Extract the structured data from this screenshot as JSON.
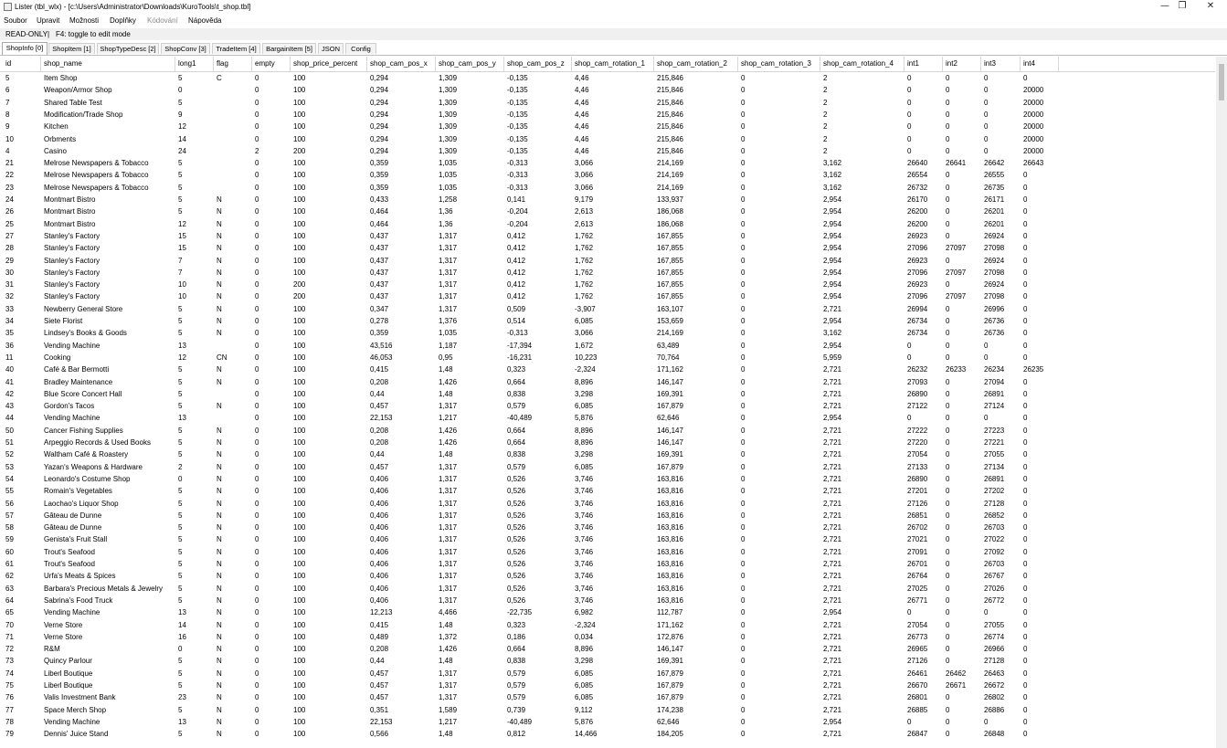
{
  "window": {
    "title": "Lister (tbl_wlx) - [c:\\Users\\Administrator\\Downloads\\KuroTools\\t_shop.tbl]",
    "minimize_glyph": "—",
    "restore_glyph": "❐",
    "close_glyph": "✕"
  },
  "menu": [
    "Soubor",
    "Upravit",
    "Možnosti",
    "Doplňky",
    "Kódování",
    "Nápověda"
  ],
  "status": {
    "mode": "READ-ONLY",
    "separator": "|",
    "hint": "F4: toggle to edit mode"
  },
  "tabs": [
    "ShopInfo [0]",
    "ShopItem [1]",
    "ShopTypeDesc [2]",
    "ShopConv [3]",
    "TradeItem [4]",
    "BargainItem [5]",
    "JSON",
    "Config"
  ],
  "active_tab": 0,
  "columns": [
    "id",
    "shop_name",
    "long1",
    "flag",
    "empty",
    "shop_price_percent",
    "shop_cam_pos_x",
    "shop_cam_pos_y",
    "shop_cam_pos_z",
    "shop_cam_rotation_1",
    "shop_cam_rotation_2",
    "shop_cam_rotation_3",
    "shop_cam_rotation_4",
    "int1",
    "int2",
    "int3",
    "int4"
  ],
  "rows": [
    [
      "5",
      "Item Shop",
      "5",
      "C",
      "0",
      "100",
      "0,294",
      "1,309",
      "-0,135",
      "4,46",
      "215,846",
      "0",
      "2",
      "0",
      "0",
      "0",
      "0"
    ],
    [
      "6",
      "Weapon/Armor Shop",
      "0",
      "",
      "0",
      "100",
      "0,294",
      "1,309",
      "-0,135",
      "4,46",
      "215,846",
      "0",
      "2",
      "0",
      "0",
      "0",
      "20000"
    ],
    [
      "7",
      "Shared Table Test",
      "5",
      "",
      "0",
      "100",
      "0,294",
      "1,309",
      "-0,135",
      "4,46",
      "215,846",
      "0",
      "2",
      "0",
      "0",
      "0",
      "20000"
    ],
    [
      "8",
      "Modification/Trade Shop",
      "9",
      "",
      "0",
      "100",
      "0,294",
      "1,309",
      "-0,135",
      "4,46",
      "215,846",
      "0",
      "2",
      "0",
      "0",
      "0",
      "20000"
    ],
    [
      "9",
      "Kitchen",
      "12",
      "",
      "0",
      "100",
      "0,294",
      "1,309",
      "-0,135",
      "4,46",
      "215,846",
      "0",
      "2",
      "0",
      "0",
      "0",
      "20000"
    ],
    [
      "10",
      "Orbments",
      "14",
      "",
      "0",
      "100",
      "0,294",
      "1,309",
      "-0,135",
      "4,46",
      "215,846",
      "0",
      "2",
      "0",
      "0",
      "0",
      "20000"
    ],
    [
      "4",
      "Casino",
      "24",
      "",
      "2",
      "200",
      "0,294",
      "1,309",
      "-0,135",
      "4,46",
      "215,846",
      "0",
      "2",
      "0",
      "0",
      "0",
      "20000"
    ],
    [
      "21",
      "Melrose Newspapers & Tobacco",
      "5",
      "",
      "0",
      "100",
      "0,359",
      "1,035",
      "-0,313",
      "3,066",
      "214,169",
      "0",
      "3,162",
      "26640",
      "26641",
      "26642",
      "26643"
    ],
    [
      "22",
      "Melrose Newspapers & Tobacco",
      "5",
      "",
      "0",
      "100",
      "0,359",
      "1,035",
      "-0,313",
      "3,066",
      "214,169",
      "0",
      "3,162",
      "26554",
      "0",
      "26555",
      "0"
    ],
    [
      "23",
      "Melrose Newspapers & Tobacco",
      "5",
      "",
      "0",
      "100",
      "0,359",
      "1,035",
      "-0,313",
      "3,066",
      "214,169",
      "0",
      "3,162",
      "26732",
      "0",
      "26735",
      "0"
    ],
    [
      "24",
      "Montmart Bistro",
      "5",
      "N",
      "0",
      "100",
      "0,433",
      "1,258",
      "0,141",
      "9,179",
      "133,937",
      "0",
      "2,954",
      "26170",
      "0",
      "26171",
      "0"
    ],
    [
      "26",
      "Montmart Bistro",
      "5",
      "N",
      "0",
      "100",
      "0,464",
      "1,36",
      "-0,204",
      "2,613",
      "186,068",
      "0",
      "2,954",
      "26200",
      "0",
      "26201",
      "0"
    ],
    [
      "25",
      "Montmart Bistro",
      "12",
      "N",
      "0",
      "100",
      "0,464",
      "1,36",
      "-0,204",
      "2,613",
      "186,068",
      "0",
      "2,954",
      "26200",
      "0",
      "26201",
      "0"
    ],
    [
      "27",
      "Stanley's Factory",
      "15",
      "N",
      "0",
      "100",
      "0,437",
      "1,317",
      "0,412",
      "1,762",
      "167,855",
      "0",
      "2,954",
      "26923",
      "0",
      "26924",
      "0"
    ],
    [
      "28",
      "Stanley's Factory",
      "15",
      "N",
      "0",
      "100",
      "0,437",
      "1,317",
      "0,412",
      "1,762",
      "167,855",
      "0",
      "2,954",
      "27096",
      "27097",
      "27098",
      "0"
    ],
    [
      "29",
      "Stanley's Factory",
      "7",
      "N",
      "0",
      "100",
      "0,437",
      "1,317",
      "0,412",
      "1,762",
      "167,855",
      "0",
      "2,954",
      "26923",
      "0",
      "26924",
      "0"
    ],
    [
      "30",
      "Stanley's Factory",
      "7",
      "N",
      "0",
      "100",
      "0,437",
      "1,317",
      "0,412",
      "1,762",
      "167,855",
      "0",
      "2,954",
      "27096",
      "27097",
      "27098",
      "0"
    ],
    [
      "31",
      "Stanley's Factory",
      "10",
      "N",
      "0",
      "200",
      "0,437",
      "1,317",
      "0,412",
      "1,762",
      "167,855",
      "0",
      "2,954",
      "26923",
      "0",
      "26924",
      "0"
    ],
    [
      "32",
      "Stanley's Factory",
      "10",
      "N",
      "0",
      "200",
      "0,437",
      "1,317",
      "0,412",
      "1,762",
      "167,855",
      "0",
      "2,954",
      "27096",
      "27097",
      "27098",
      "0"
    ],
    [
      "33",
      "Newberry General Store",
      "5",
      "N",
      "0",
      "100",
      "0,347",
      "1,317",
      "0,509",
      "-3,907",
      "163,107",
      "0",
      "2,721",
      "26994",
      "0",
      "26996",
      "0"
    ],
    [
      "34",
      "Siete Florist",
      "5",
      "N",
      "0",
      "100",
      "0,278",
      "1,376",
      "0,514",
      "6,085",
      "153,659",
      "0",
      "2,954",
      "26734",
      "0",
      "26736",
      "0"
    ],
    [
      "35",
      "Lindsey's Books & Goods",
      "5",
      "N",
      "0",
      "100",
      "0,359",
      "1,035",
      "-0,313",
      "3,066",
      "214,169",
      "0",
      "3,162",
      "26734",
      "0",
      "26736",
      "0"
    ],
    [
      "36",
      "Vending Machine",
      "13",
      "",
      "0",
      "100",
      "43,516",
      "1,187",
      "-17,394",
      "1,672",
      "63,489",
      "0",
      "2,954",
      "0",
      "0",
      "0",
      "0"
    ],
    [
      "11",
      "Cooking",
      "12",
      "CN",
      "0",
      "100",
      "46,053",
      "0,95",
      "-16,231",
      "10,223",
      "70,764",
      "0",
      "5,959",
      "0",
      "0",
      "0",
      "0"
    ],
    [
      "40",
      "Café & Bar Bermotti",
      "5",
      "N",
      "0",
      "100",
      "0,415",
      "1,48",
      "0,323",
      "-2,324",
      "171,162",
      "0",
      "2,721",
      "26232",
      "26233",
      "26234",
      "26235"
    ],
    [
      "41",
      "Bradley Maintenance",
      "5",
      "N",
      "0",
      "100",
      "0,208",
      "1,426",
      "0,664",
      "8,896",
      "146,147",
      "0",
      "2,721",
      "27093",
      "0",
      "27094",
      "0"
    ],
    [
      "42",
      "Blue Score Concert Hall",
      "5",
      "",
      "0",
      "100",
      "0,44",
      "1,48",
      "0,838",
      "3,298",
      "169,391",
      "0",
      "2,721",
      "26890",
      "0",
      "26891",
      "0"
    ],
    [
      "43",
      "Gordon's Tacos",
      "5",
      "N",
      "0",
      "100",
      "0,457",
      "1,317",
      "0,579",
      "6,085",
      "167,879",
      "0",
      "2,721",
      "27122",
      "0",
      "27124",
      "0"
    ],
    [
      "44",
      "Vending Machine",
      "13",
      "",
      "0",
      "100",
      "22,153",
      "1,217",
      "-40,489",
      "5,876",
      "62,646",
      "0",
      "2,954",
      "0",
      "0",
      "0",
      "0"
    ],
    [
      "50",
      "Cancer Fishing Supplies",
      "5",
      "N",
      "0",
      "100",
      "0,208",
      "1,426",
      "0,664",
      "8,896",
      "146,147",
      "0",
      "2,721",
      "27222",
      "0",
      "27223",
      "0"
    ],
    [
      "51",
      "Arpeggio Records & Used Books",
      "5",
      "N",
      "0",
      "100",
      "0,208",
      "1,426",
      "0,664",
      "8,896",
      "146,147",
      "0",
      "2,721",
      "27220",
      "0",
      "27221",
      "0"
    ],
    [
      "52",
      "Waltham Café & Roastery",
      "5",
      "N",
      "0",
      "100",
      "0,44",
      "1,48",
      "0,838",
      "3,298",
      "169,391",
      "0",
      "2,721",
      "27054",
      "0",
      "27055",
      "0"
    ],
    [
      "53",
      "Yazan's Weapons & Hardware",
      "2",
      "N",
      "0",
      "100",
      "0,457",
      "1,317",
      "0,579",
      "6,085",
      "167,879",
      "0",
      "2,721",
      "27133",
      "0",
      "27134",
      "0"
    ],
    [
      "54",
      "Leonardo's Costume Shop",
      "0",
      "N",
      "0",
      "100",
      "0,406",
      "1,317",
      "0,526",
      "3,746",
      "163,816",
      "0",
      "2,721",
      "26890",
      "0",
      "26891",
      "0"
    ],
    [
      "55",
      "Romain's Vegetables",
      "5",
      "N",
      "0",
      "100",
      "0,406",
      "1,317",
      "0,526",
      "3,746",
      "163,816",
      "0",
      "2,721",
      "27201",
      "0",
      "27202",
      "0"
    ],
    [
      "56",
      "Laochao's Liquor Shop",
      "5",
      "N",
      "0",
      "100",
      "0,406",
      "1,317",
      "0,526",
      "3,746",
      "163,816",
      "0",
      "2,721",
      "27126",
      "0",
      "27128",
      "0"
    ],
    [
      "57",
      "Gâteau de Dunne",
      "5",
      "N",
      "0",
      "100",
      "0,406",
      "1,317",
      "0,526",
      "3,746",
      "163,816",
      "0",
      "2,721",
      "26851",
      "0",
      "26852",
      "0"
    ],
    [
      "58",
      "Gâteau de Dunne",
      "5",
      "N",
      "0",
      "100",
      "0,406",
      "1,317",
      "0,526",
      "3,746",
      "163,816",
      "0",
      "2,721",
      "26702",
      "0",
      "26703",
      "0"
    ],
    [
      "59",
      "Genista's Fruit Stall",
      "5",
      "N",
      "0",
      "100",
      "0,406",
      "1,317",
      "0,526",
      "3,746",
      "163,816",
      "0",
      "2,721",
      "27021",
      "0",
      "27022",
      "0"
    ],
    [
      "60",
      "Trout's Seafood",
      "5",
      "N",
      "0",
      "100",
      "0,406",
      "1,317",
      "0,526",
      "3,746",
      "163,816",
      "0",
      "2,721",
      "27091",
      "0",
      "27092",
      "0"
    ],
    [
      "61",
      "Trout's Seafood",
      "5",
      "N",
      "0",
      "100",
      "0,406",
      "1,317",
      "0,526",
      "3,746",
      "163,816",
      "0",
      "2,721",
      "26701",
      "0",
      "26703",
      "0"
    ],
    [
      "62",
      "Urfa's Meats & Spices",
      "5",
      "N",
      "0",
      "100",
      "0,406",
      "1,317",
      "0,526",
      "3,746",
      "163,816",
      "0",
      "2,721",
      "26764",
      "0",
      "26767",
      "0"
    ],
    [
      "63",
      "Barbara's Precious Metals & Jewelry",
      "5",
      "N",
      "0",
      "100",
      "0,406",
      "1,317",
      "0,526",
      "3,746",
      "163,816",
      "0",
      "2,721",
      "27025",
      "0",
      "27026",
      "0"
    ],
    [
      "64",
      "Sabrina's Food Truck",
      "5",
      "N",
      "0",
      "100",
      "0,406",
      "1,317",
      "0,526",
      "3,746",
      "163,816",
      "0",
      "2,721",
      "26771",
      "0",
      "26772",
      "0"
    ],
    [
      "65",
      "Vending Machine",
      "13",
      "N",
      "0",
      "100",
      "12,213",
      "4,466",
      "-22,735",
      "6,982",
      "112,787",
      "0",
      "2,954",
      "0",
      "0",
      "0",
      "0"
    ],
    [
      "70",
      "Verne Store",
      "14",
      "N",
      "0",
      "100",
      "0,415",
      "1,48",
      "0,323",
      "-2,324",
      "171,162",
      "0",
      "2,721",
      "27054",
      "0",
      "27055",
      "0"
    ],
    [
      "71",
      "Verne Store",
      "16",
      "N",
      "0",
      "100",
      "0,489",
      "1,372",
      "0,186",
      "0,034",
      "172,876",
      "0",
      "2,721",
      "26773",
      "0",
      "26774",
      "0"
    ],
    [
      "72",
      "R&M",
      "0",
      "N",
      "0",
      "100",
      "0,208",
      "1,426",
      "0,664",
      "8,896",
      "146,147",
      "0",
      "2,721",
      "26965",
      "0",
      "26966",
      "0"
    ],
    [
      "73",
      "Quincy Parlour",
      "5",
      "N",
      "0",
      "100",
      "0,44",
      "1,48",
      "0,838",
      "3,298",
      "169,391",
      "0",
      "2,721",
      "27126",
      "0",
      "27128",
      "0"
    ],
    [
      "74",
      "Liberl Boutique",
      "5",
      "N",
      "0",
      "100",
      "0,457",
      "1,317",
      "0,579",
      "6,085",
      "167,879",
      "0",
      "2,721",
      "26461",
      "26462",
      "26463",
      "0"
    ],
    [
      "75",
      "Liberl Boutique",
      "5",
      "N",
      "0",
      "100",
      "0,457",
      "1,317",
      "0,579",
      "6,085",
      "167,879",
      "0",
      "2,721",
      "26670",
      "26671",
      "26672",
      "0"
    ],
    [
      "76",
      "Valis Investment Bank",
      "23",
      "N",
      "0",
      "100",
      "0,457",
      "1,317",
      "0,579",
      "6,085",
      "167,879",
      "0",
      "2,721",
      "26801",
      "0",
      "26802",
      "0"
    ],
    [
      "77",
      "Space Merch Shop",
      "5",
      "N",
      "0",
      "100",
      "0,351",
      "1,589",
      "0,739",
      "9,112",
      "174,238",
      "0",
      "2,721",
      "26885",
      "0",
      "26886",
      "0"
    ],
    [
      "78",
      "Vending Machine",
      "13",
      "N",
      "0",
      "100",
      "22,153",
      "1,217",
      "-40,489",
      "5,876",
      "62,646",
      "0",
      "2,954",
      "0",
      "0",
      "0",
      "0"
    ],
    [
      "79",
      "Dennis' Juice Stand",
      "5",
      "N",
      "0",
      "100",
      "0,566",
      "1,48",
      "0,812",
      "14,466",
      "184,205",
      "0",
      "2,721",
      "26847",
      "0",
      "26848",
      "0"
    ]
  ]
}
